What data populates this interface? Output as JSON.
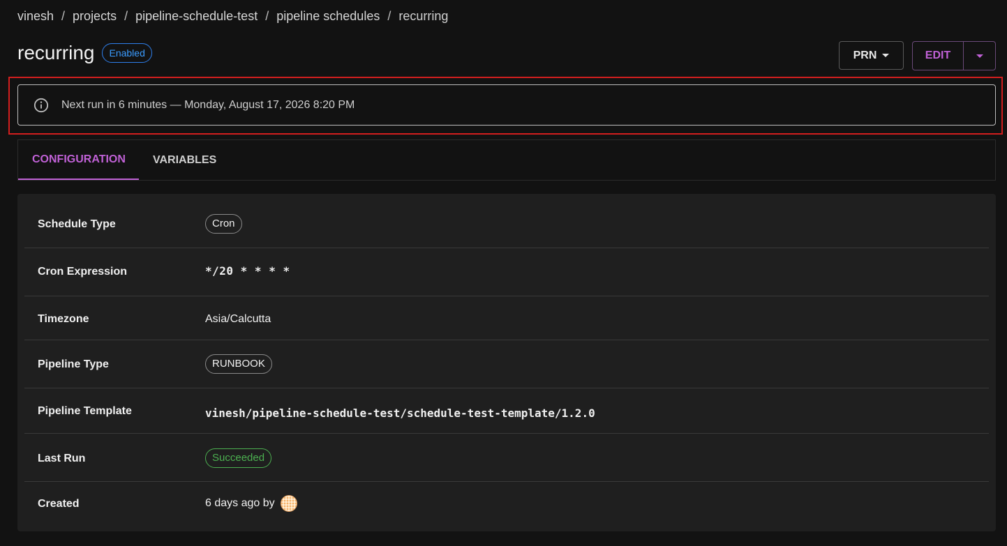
{
  "breadcrumb": {
    "items": [
      "vinesh",
      "projects",
      "pipeline-schedule-test",
      "pipeline schedules",
      "recurring"
    ],
    "separator": "/"
  },
  "header": {
    "title": "recurring",
    "status_badge": "Enabled",
    "prn_label": "PRN",
    "edit_label": "EDIT"
  },
  "alert": {
    "icon": "info-icon",
    "text": "Next run in 6 minutes — Monday, August 17, 2026 8:20 PM"
  },
  "tabs": [
    {
      "label": "CONFIGURATION",
      "active": true
    },
    {
      "label": "VARIABLES",
      "active": false
    }
  ],
  "details": {
    "schedule_type": {
      "label": "Schedule Type",
      "value": "Cron"
    },
    "cron_expression": {
      "label": "Cron Expression",
      "value": "*/20 * * * *"
    },
    "timezone": {
      "label": "Timezone",
      "value": "Asia/Calcutta"
    },
    "pipeline_type": {
      "label": "Pipeline Type",
      "value": "RUNBOOK"
    },
    "pipeline_template": {
      "label": "Pipeline Template",
      "value": "vinesh/pipeline-schedule-test/schedule-test-template/1.2.0"
    },
    "last_run": {
      "label": "Last Run",
      "value": "Succeeded"
    },
    "created": {
      "label": "Created",
      "value": "6 days ago by"
    }
  },
  "colors": {
    "accent": "#c061d6",
    "badge_blue": "#2f80ed",
    "success": "#4caf50",
    "highlight": "#d21e1e",
    "background": "#121212",
    "card": "#1f1f1f"
  }
}
